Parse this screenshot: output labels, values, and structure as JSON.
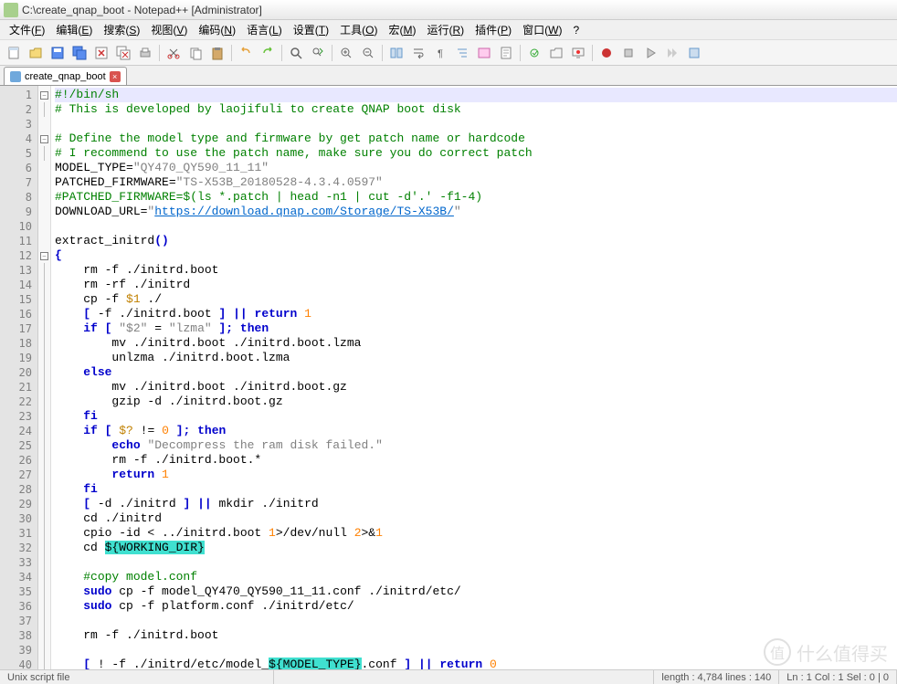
{
  "window": {
    "title": "C:\\create_qnap_boot - Notepad++ [Administrator]"
  },
  "menu": {
    "items": [
      {
        "label": "文件",
        "key": "F"
      },
      {
        "label": "编辑",
        "key": "E"
      },
      {
        "label": "搜索",
        "key": "S"
      },
      {
        "label": "视图",
        "key": "V"
      },
      {
        "label": "编码",
        "key": "N"
      },
      {
        "label": "语言",
        "key": "L"
      },
      {
        "label": "设置",
        "key": "T"
      },
      {
        "label": "工具",
        "key": "O"
      },
      {
        "label": "宏",
        "key": "M"
      },
      {
        "label": "运行",
        "key": "R"
      },
      {
        "label": "插件",
        "key": "P"
      },
      {
        "label": "窗口",
        "key": "W"
      },
      {
        "label": "?",
        "key": ""
      }
    ]
  },
  "tab": {
    "label": "create_qnap_boot",
    "close": "×"
  },
  "code": {
    "lines": [
      {
        "n": 1,
        "fold": "box",
        "hl": true,
        "html": "<span class='cm'>#!/bin/sh</span>"
      },
      {
        "n": 2,
        "fold": "line",
        "html": "<span class='cm'># This is developed by laojifuli to create QNAP boot disk</span>"
      },
      {
        "n": 3,
        "fold": "",
        "html": ""
      },
      {
        "n": 4,
        "fold": "box",
        "html": "<span class='cm'># Define the model type and firmware by get patch name or hardcode</span>"
      },
      {
        "n": 5,
        "fold": "line",
        "html": "<span class='cm'># I recommend to use the patch name, make sure you do correct patch</span>"
      },
      {
        "n": 6,
        "fold": "",
        "html": "MODEL_TYPE=<span class='str'>\"QY470_QY590_11_11\"</span>"
      },
      {
        "n": 7,
        "fold": "",
        "html": "PATCHED_FIRMWARE=<span class='str'>\"TS-X53B_20180528-4.3.4.0597\"</span>"
      },
      {
        "n": 8,
        "fold": "",
        "html": "<span class='cm'>#PATCHED_FIRMWARE=$(ls *.patch | head -n1 | cut -d'.' -f1-4)</span>"
      },
      {
        "n": 9,
        "fold": "",
        "html": "DOWNLOAD_URL=<span class='str'>\"<span class='url'>https://download.qnap.com/Storage/TS-X53B/</span>\"</span>"
      },
      {
        "n": 10,
        "fold": "",
        "html": ""
      },
      {
        "n": 11,
        "fold": "",
        "html": "extract_initrd<span class='kw'>()</span>"
      },
      {
        "n": 12,
        "fold": "box",
        "html": "<span class='kw'>{</span>"
      },
      {
        "n": 13,
        "fold": "line",
        "html": "    rm -f ./initrd.boot"
      },
      {
        "n": 14,
        "fold": "line",
        "html": "    rm -rf ./initrd"
      },
      {
        "n": 15,
        "fold": "line",
        "html": "    cp -f <span class='var'>$1</span> ./"
      },
      {
        "n": 16,
        "fold": "line",
        "html": "    <span class='kw'>[</span> -f ./initrd.boot <span class='kw'>]</span> <span class='kw'>||</span> <span class='kw'>return</span> <span class='num'>1</span>"
      },
      {
        "n": 17,
        "fold": "line",
        "html": "    <span class='kw'>if [</span> <span class='str'>\"$2\"</span> = <span class='str'>\"lzma\"</span> <span class='kw'>];</span> <span class='kw'>then</span>"
      },
      {
        "n": 18,
        "fold": "line",
        "html": "        mv ./initrd.boot ./initrd.boot.lzma"
      },
      {
        "n": 19,
        "fold": "line",
        "html": "        unlzma ./initrd.boot.lzma"
      },
      {
        "n": 20,
        "fold": "line",
        "html": "    <span class='kw'>else</span>"
      },
      {
        "n": 21,
        "fold": "line",
        "html": "        mv ./initrd.boot ./initrd.boot.gz"
      },
      {
        "n": 22,
        "fold": "line",
        "html": "        gzip -d ./initrd.boot.gz"
      },
      {
        "n": 23,
        "fold": "line",
        "html": "    <span class='kw'>fi</span>"
      },
      {
        "n": 24,
        "fold": "line",
        "html": "    <span class='kw'>if [</span> <span class='var'>$?</span> != <span class='num'>0</span> <span class='kw'>];</span> <span class='kw'>then</span>"
      },
      {
        "n": 25,
        "fold": "line",
        "html": "        <span class='kw'>echo</span> <span class='str'>\"Decompress the ram disk failed.\"</span>"
      },
      {
        "n": 26,
        "fold": "line",
        "html": "        rm -f ./initrd.boot.*"
      },
      {
        "n": 27,
        "fold": "line",
        "html": "        <span class='kw'>return</span> <span class='num'>1</span>"
      },
      {
        "n": 28,
        "fold": "line",
        "html": "    <span class='kw'>fi</span>"
      },
      {
        "n": 29,
        "fold": "line",
        "html": "    <span class='kw'>[</span> -d ./initrd <span class='kw'>]</span> <span class='kw'>||</span> mkdir ./initrd"
      },
      {
        "n": 30,
        "fold": "line",
        "html": "    cd ./initrd"
      },
      {
        "n": 31,
        "fold": "line",
        "html": "    cpio -id &lt; ../initrd.boot <span class='num'>1</span>&gt;/dev/null <span class='num'>2</span>&gt;&amp;<span class='num'>1</span>"
      },
      {
        "n": 32,
        "fold": "line",
        "html": "    cd <span class='sel'>${WORKING_DIR}</span>"
      },
      {
        "n": 33,
        "fold": "line",
        "html": ""
      },
      {
        "n": 34,
        "fold": "line",
        "html": "    <span class='cm'>#copy model.conf</span>"
      },
      {
        "n": 35,
        "fold": "line",
        "html": "    <span class='kw'>sudo</span> cp -f model_QY470_QY590_11_11.conf ./initrd/etc/"
      },
      {
        "n": 36,
        "fold": "line",
        "html": "    <span class='kw'>sudo</span> cp -f platform.conf ./initrd/etc/"
      },
      {
        "n": 37,
        "fold": "line",
        "html": ""
      },
      {
        "n": 38,
        "fold": "line",
        "html": "    rm -f ./initrd.boot"
      },
      {
        "n": 39,
        "fold": "line",
        "html": ""
      },
      {
        "n": 40,
        "fold": "line",
        "html": "    <span class='kw'>[</span> ! -f ./initrd/etc/model_<span class='sel'>${MODEL_TYPE}</span>.conf <span class='kw'>]</span> <span class='kw'>||</span> <span class='kw'>return</span> <span class='num'>0</span>"
      }
    ]
  },
  "status": {
    "filetype": "Unix script file",
    "length": "length : 4,784    lines : 140",
    "pos": "Ln : 1    Col : 1    Sel : 0 | 0"
  },
  "watermark": {
    "icon": "值",
    "text": "什么值得买"
  }
}
